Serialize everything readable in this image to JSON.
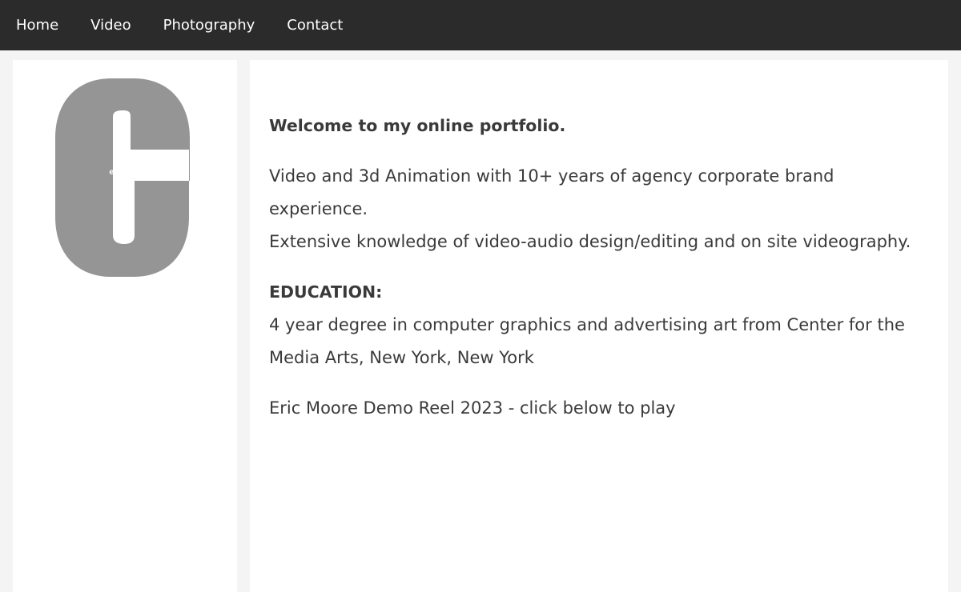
{
  "nav": {
    "items": [
      {
        "label": "Home"
      },
      {
        "label": "Video"
      },
      {
        "label": "Photography"
      },
      {
        "label": "Contact"
      }
    ]
  },
  "sidebar": {
    "logo_text": "eric moore portfolio",
    "logo_color": "#959595"
  },
  "main": {
    "welcome": "Welcome to my online portfolio.",
    "intro_line1": "Video and 3d Animation with 10+ years of agency corporate brand experience.",
    "intro_line2": "Extensive knowledge of video-audio design/editing and on site videography.",
    "education_heading": "EDUCATION:",
    "education_text": "4 year degree in computer graphics and advertising art from Center for the Media Arts, New York, New York",
    "demo_reel": "Eric Moore Demo Reel 2023 - click below to play"
  }
}
